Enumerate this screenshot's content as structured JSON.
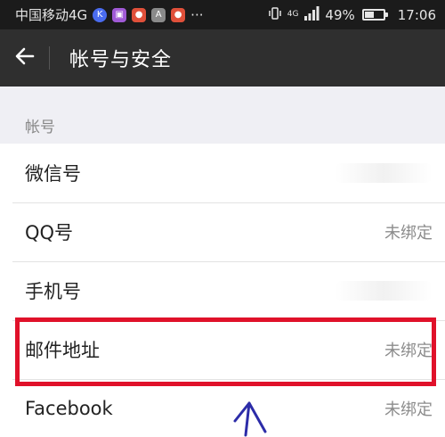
{
  "status_bar": {
    "carrier": "中国移动4G",
    "more": "···",
    "network": "4G",
    "battery_percent": "49%",
    "battery_level": 0.49,
    "time": "17:06"
  },
  "header": {
    "title": "帐号与安全",
    "back_icon": "arrow-left-icon"
  },
  "section": {
    "title": "帐号"
  },
  "items": [
    {
      "label": "微信号",
      "value": ""
    },
    {
      "label": "QQ号",
      "value": "未绑定"
    },
    {
      "label": "手机号",
      "value": ""
    },
    {
      "label": "邮件地址",
      "value": "未绑定"
    },
    {
      "label": "Facebook",
      "value": "未绑定"
    }
  ],
  "colors": {
    "status_bar_bg": "#1b1b1b",
    "title_bar_bg": "#2f2f2f",
    "highlight": "#e0112a",
    "annotation_arrow": "#2c2ca8"
  }
}
